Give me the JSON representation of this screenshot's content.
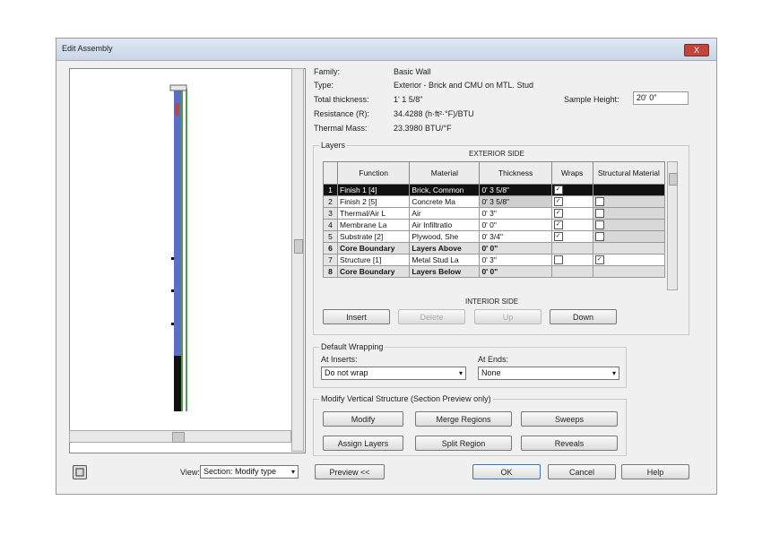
{
  "dialog": {
    "title": "Edit Assembly",
    "close_label": "X"
  },
  "info": {
    "family_label": "Family:",
    "family_value": "Basic Wall",
    "type_label": "Type:",
    "type_value": "Exterior - Brick and CMU on MTL. Stud",
    "thickness_label": "Total thickness:",
    "thickness_value": "1' 1 5/8\"",
    "resistance_label": "Resistance (R):",
    "resistance_value": "34.4288 (h·ft²·°F)/BTU",
    "mass_label": "Thermal Mass:",
    "mass_value": "23.3980 BTU/°F",
    "sample_height_label": "Sample Height:",
    "sample_height_value": "20' 0\""
  },
  "layers": {
    "group_title": "Layers",
    "exterior_label": "EXTERIOR SIDE",
    "interior_label": "INTERIOR SIDE",
    "columns": [
      "",
      "Function",
      "Material",
      "Thickness",
      "Wraps",
      "Structural Material"
    ],
    "rows": [
      {
        "num": "1",
        "function": "Finish 1 [4]",
        "material": "Brick, Common",
        "thickness": "0' 3 5/8\"",
        "wraps": "check",
        "structural": ""
      },
      {
        "num": "2",
        "function": "Finish 2 [5]",
        "material": "Concrete Ma",
        "thickness": "0' 3 5/8\"",
        "wraps": "check",
        "structural": ""
      },
      {
        "num": "3",
        "function": "Thermal/Air L",
        "material": "Air",
        "thickness": "0' 3\"",
        "wraps": "check",
        "structural": ""
      },
      {
        "num": "4",
        "function": "Membrane La",
        "material": "Air Infiltratio",
        "thickness": "0' 0\"",
        "wraps": "check",
        "structural": ""
      },
      {
        "num": "5",
        "function": "Substrate [2]",
        "material": "Plywood, She",
        "thickness": "0' 3/4\"",
        "wraps": "check",
        "structural": ""
      },
      {
        "num": "6",
        "function": "Core Boundary",
        "material": "Layers Above",
        "thickness": "0' 0\"",
        "wraps": "",
        "structural": ""
      },
      {
        "num": "7",
        "function": "Structure [1]",
        "material": "Metal Stud La",
        "thickness": "0' 3\"",
        "wraps": "box",
        "structural": "check"
      },
      {
        "num": "8",
        "function": "Core Boundary",
        "material": "Layers Below",
        "thickness": "0' 0\"",
        "wraps": "",
        "structural": ""
      }
    ],
    "buttons": {
      "insert": "Insert",
      "delete": "Delete",
      "up": "Up",
      "down": "Down"
    }
  },
  "wrapping": {
    "group_title": "Default Wrapping",
    "inserts_label": "At Inserts:",
    "inserts_value": "Do not wrap",
    "ends_label": "At Ends:",
    "ends_value": "None"
  },
  "modify": {
    "group_title": "Modify Vertical Structure (Section Preview only)",
    "modify": "Modify",
    "merge": "Merge Regions",
    "sweeps": "Sweeps",
    "assign": "Assign Layers",
    "split": "Split Region",
    "reveals": "Reveals"
  },
  "footer": {
    "view_label": "View:",
    "view_value": "Section: Modify type",
    "preview_button": "Preview <<",
    "ok": "OK",
    "cancel": "Cancel",
    "help": "Help"
  },
  "colors": {
    "selection": "#111111",
    "titlebar": "#d4dfee",
    "wall_blue": "#5b6fc6",
    "wall_green": "#4aa04a"
  }
}
